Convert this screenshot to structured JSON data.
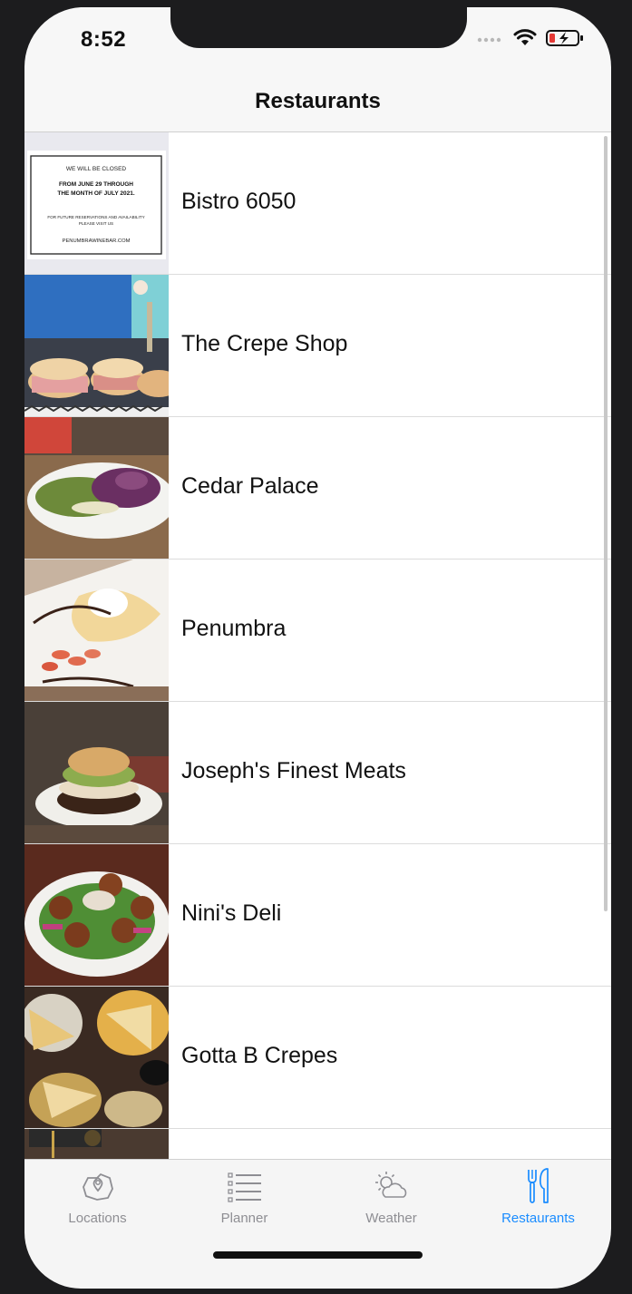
{
  "status_bar": {
    "time": "8:52"
  },
  "nav": {
    "title": "Restaurants"
  },
  "restaurants": [
    {
      "name": "Bistro 6050",
      "thumb": "closed-notice"
    },
    {
      "name": "The Crepe Shop",
      "thumb": "sandwiches"
    },
    {
      "name": "Cedar Palace",
      "thumb": "wrap-salad"
    },
    {
      "name": "Penumbra",
      "thumb": "crepe-dessert"
    },
    {
      "name": "Joseph's Finest Meats",
      "thumb": "burger"
    },
    {
      "name": "Nini's Deli",
      "thumb": "falafel"
    },
    {
      "name": "Gotta B Crepes",
      "thumb": "savory-crepes"
    }
  ],
  "closed_notice": {
    "line1": "WE WILL BE CLOSED",
    "line2": "FROM JUNE 29 THROUGH",
    "line3": "THE MONTH OF JULY 2021.",
    "line4": "FOR FUTURE RESERVATIONS AND AVAILABILITY",
    "line5": "PLEASE VISIT US",
    "line6": "PENUMBRAWINEBAR.COM"
  },
  "tabs": [
    {
      "label": "Locations",
      "icon": "map-pin-icon",
      "active": false
    },
    {
      "label": "Planner",
      "icon": "list-icon",
      "active": false
    },
    {
      "label": "Weather",
      "icon": "partly-cloudy-icon",
      "active": false
    },
    {
      "label": "Restaurants",
      "icon": "fork-knife-icon",
      "active": true
    }
  ],
  "colors": {
    "accent": "#1a8cff",
    "inactive": "#8e8e93"
  }
}
